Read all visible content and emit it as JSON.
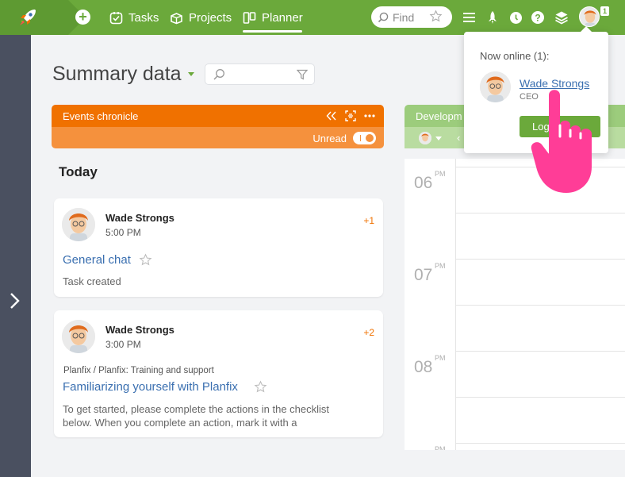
{
  "nav": {
    "tasks": "Tasks",
    "projects": "Projects",
    "planner": "Planner",
    "find_placeholder": "Find",
    "profile_badge": "1"
  },
  "page": {
    "title": "Summary data"
  },
  "events_panel": {
    "title": "Events chronicle",
    "unread_label": "Unread",
    "section": "Today",
    "items": [
      {
        "author": "Wade Strongs",
        "time": "5:00 PM",
        "count": "+1",
        "breadcrumb": "",
        "title": "General chat",
        "description": "Task created"
      },
      {
        "author": "Wade Strongs",
        "time": "3:00 PM",
        "count": "+2",
        "breadcrumb": "Planfix / Planfix: Training and support",
        "title": "Familiarizing yourself with Planfix",
        "description_line1": "To get started, please complete the actions in the checklist",
        "description_line2": "below. When you complete an action, mark it with a"
      }
    ]
  },
  "dev_panel": {
    "title": "Developm",
    "hours": [
      {
        "hour": "06",
        "ampm": "PM"
      },
      {
        "hour": "07",
        "ampm": "PM"
      },
      {
        "hour": "08",
        "ampm": "PM"
      },
      {
        "hour": "",
        "ampm": "PM"
      }
    ]
  },
  "online_popover": {
    "title": "Now online (1):",
    "user_name": "Wade Strongs",
    "user_role": "CEO",
    "logout_label": "Log"
  },
  "colors": {
    "topbar": "#6ba93b",
    "events_header": "#f07100",
    "events_subbar": "#f5913d",
    "dev_header": "#9ccc7c",
    "link": "#3a6fb0",
    "cursor": "#ff3d97"
  }
}
